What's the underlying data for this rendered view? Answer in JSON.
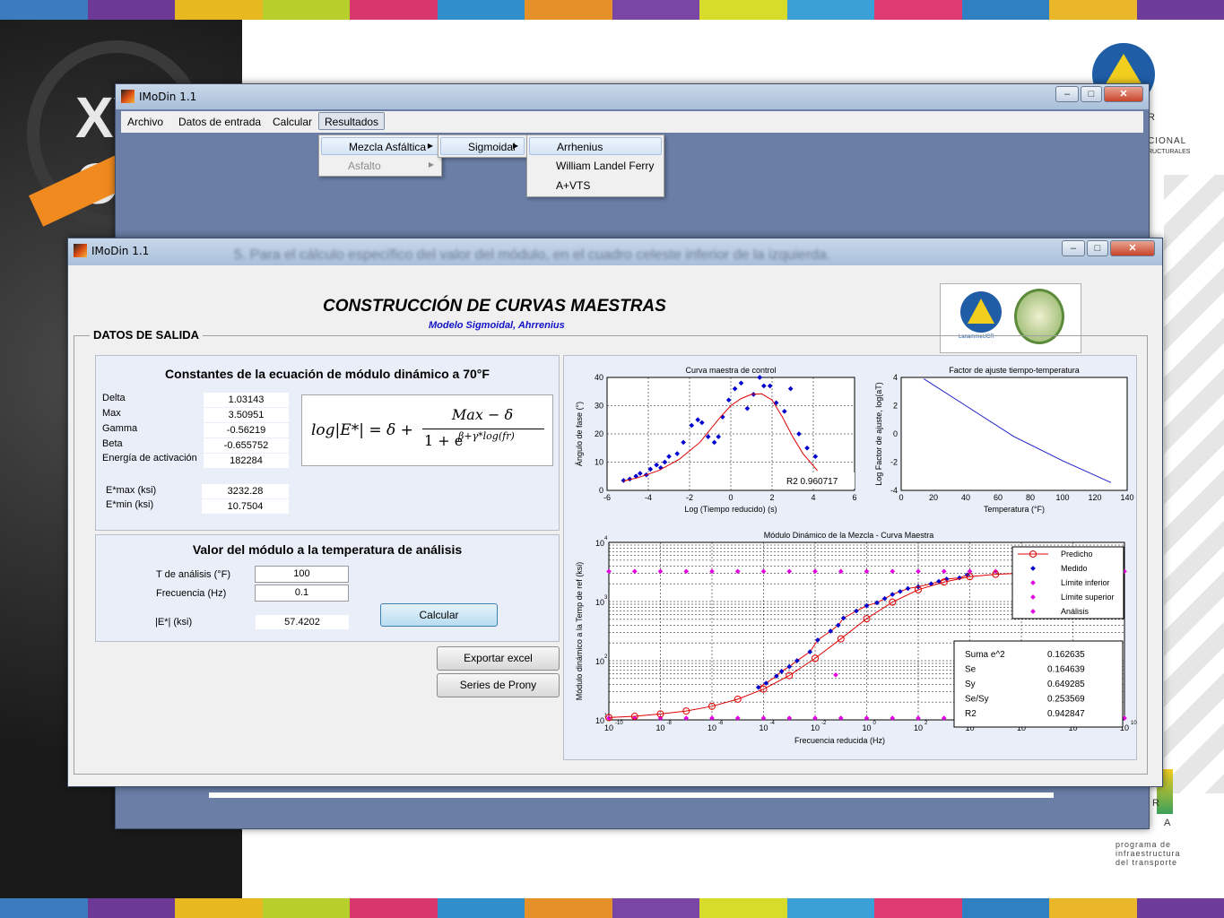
{
  "colors": {
    "stripes": [
      "#3b7bbf",
      "#6c3a96",
      "#e8b821",
      "#b6cf2b",
      "#d8366c",
      "#2e8fca",
      "#e6902a",
      "#7a46a6",
      "#d7dc2a",
      "#3ba0d6",
      "#e03a73",
      "#2f7fc3",
      "#eab62a",
      "#6d3c9a"
    ],
    "app_bg": "#6a7ea6",
    "panel_bg": "#e9eef8",
    "window_bg": "#f0f0f0"
  },
  "background": {
    "side_logo_text": "XVII C",
    "corner_letters": [
      "R",
      "R",
      "A"
    ],
    "right_texts": [
      "CIONAL",
      "RUCTURALES"
    ],
    "bottom_right_text": [
      "programa de",
      "infraestructura",
      "del transporte"
    ]
  },
  "back_window": {
    "title": "IMoDin 1.1",
    "menu": [
      "Archivo",
      "Datos de entrada",
      "Calcular",
      "Resultados"
    ],
    "submenu1": [
      {
        "label": "Mezcla Asfáltica",
        "enabled": true
      },
      {
        "label": "Asfalto",
        "enabled": false
      }
    ],
    "submenu2": [
      "Sigmoidal"
    ],
    "submenu3": [
      "Arrhenius",
      "William Landel Ferry",
      "A+VTS"
    ]
  },
  "front_window": {
    "title": "IMoDin 1.1",
    "blurred_text": "5.   Para el cálculo específico del valor del módulo, en el cuadro celeste inferior de la izquierda.",
    "heading": "CONSTRUCCIÓN DE CURVAS MAESTRAS",
    "subheading": "Modelo Sigmoidal, Ahrrenius",
    "logo_caption": "LanammeUCR",
    "section_title": "DATOS DE SALIDA",
    "constants_title": "Constantes de la ecuación de módulo dinámico a 70°F",
    "constants": [
      {
        "label": "Delta",
        "value": "1.03143"
      },
      {
        "label": "Max",
        "value": "3.50951"
      },
      {
        "label": "Gamma",
        "value": "-0.56219"
      },
      {
        "label": "Beta",
        "value": "-0.655752"
      },
      {
        "label": "Energía de activación",
        "value": "182284"
      }
    ],
    "extremes": [
      {
        "label": "E*max (ksi)",
        "value": "3232.28"
      },
      {
        "label": "E*min (ksi)",
        "value": "10.7504"
      }
    ],
    "formula": {
      "lhs": "log|E*| = δ +",
      "numerator": "Max − δ",
      "denominator": "1 + e",
      "exponent": "β+γ*log(fr)"
    },
    "module_title": "Valor del módulo a la temperatura de análisis",
    "inputs": [
      {
        "label": "T de análisis (°F)",
        "value": "100"
      },
      {
        "label": "Frecuencia (Hz)",
        "value": "0.1"
      }
    ],
    "result": {
      "label": "|E*| (ksi)",
      "value": "57.4202"
    },
    "buttons": {
      "calcular": "Calcular",
      "exportar": "Exportar excel",
      "prony": "Series de Prony"
    }
  },
  "chart_data": [
    {
      "type": "scatter",
      "title": "Curva maestra de control",
      "xlabel": "Log (Tiempo reducido) (s)",
      "ylabel": "Ángulo de fase (°)",
      "xlim": [
        -6,
        6
      ],
      "ylim": [
        0,
        40
      ],
      "xticks": [
        -6,
        -4,
        -2,
        0,
        2,
        4,
        6
      ],
      "yticks": [
        0,
        10,
        20,
        30,
        40
      ],
      "grid": true,
      "annotation": "R2   0.960717",
      "series": [
        {
          "kind": "points",
          "color": "#0000d0",
          "x": [
            -5.2,
            -4.9,
            -4.6,
            -4.4,
            -4.1,
            -3.9,
            -3.6,
            -3.4,
            -3.2,
            -3.0,
            -2.6,
            -2.3,
            -1.9,
            -1.6,
            -1.4,
            -1.1,
            -0.8,
            -0.6,
            -0.4,
            -0.1,
            0.2,
            0.5,
            0.8,
            1.1,
            1.4,
            1.6,
            1.9,
            2.2,
            2.6,
            2.9,
            3.3,
            3.7,
            4.1
          ],
          "y": [
            3.5,
            4,
            5,
            6,
            5.5,
            7.5,
            9,
            8,
            10,
            12,
            13,
            17,
            23,
            25,
            24,
            19,
            17,
            19,
            26,
            32,
            36,
            38,
            29,
            34,
            40,
            37,
            37,
            31,
            28,
            36,
            20,
            15,
            12
          ]
        },
        {
          "kind": "line",
          "color": "#e00000",
          "x": [
            -5.2,
            -4.5,
            -3.5,
            -2.5,
            -1.5,
            -0.5,
            0,
            0.5,
            1,
            1.5,
            2,
            2.5,
            3,
            3.5,
            4.2
          ],
          "y": [
            3.3,
            4.5,
            7,
            11,
            17,
            26,
            30,
            32.5,
            34,
            34.2,
            32,
            26,
            19,
            13,
            7
          ]
        }
      ]
    },
    {
      "type": "line",
      "title": "Factor de ajuste tiempo-temperatura",
      "xlabel": "Temperatura (°F)",
      "ylabel": "Log Factor de ajuste, log(aT)",
      "xlim": [
        0,
        140
      ],
      "ylim": [
        -4,
        4
      ],
      "xticks": [
        0,
        20,
        40,
        60,
        80,
        100,
        120,
        140
      ],
      "yticks": [
        -4,
        -2,
        0,
        2,
        4
      ],
      "series": [
        {
          "kind": "line",
          "color": "#2020c8",
          "x": [
            14,
            40,
            70,
            100,
            130
          ],
          "y": [
            3.9,
            2.0,
            -0.2,
            -1.9,
            -3.45
          ]
        }
      ]
    },
    {
      "type": "line",
      "title": "Módulo Dinámico de la Mezcla - Curva Maestra",
      "xlabel": "Frecuencia reducida (Hz)",
      "ylabel": "Módulo dinámico a la Temp de ref (ksi)",
      "xscale": "log",
      "yscale": "log",
      "xlim_exp": [
        -10,
        10
      ],
      "ylim_exp": [
        1,
        4
      ],
      "xticks_exp": [
        -10,
        -8,
        -6,
        -4,
        -2,
        0,
        2,
        4,
        6,
        8,
        10
      ],
      "yticks_exp": [
        1,
        2,
        3,
        4
      ],
      "legend_position": "top-right",
      "legend": [
        "Predicho",
        "Medido",
        "Límite inferior",
        "Límite superior",
        "Análisis"
      ],
      "stats": [
        {
          "label": "Suma e^2",
          "value": "0.162635"
        },
        {
          "label": "Se",
          "value": "0.164639"
        },
        {
          "label": "Sy",
          "value": "0.649285"
        },
        {
          "label": "Se/Sy",
          "value": "0.253569"
        },
        {
          "label": "R2",
          "value": "0.942847"
        }
      ],
      "series": [
        {
          "name": "Predicho",
          "kind": "line_circles",
          "color": "#e00000",
          "logx": [
            -10,
            -9,
            -8,
            -7,
            -6,
            -5,
            -4,
            -3,
            -2,
            -1,
            0,
            1,
            2,
            3,
            4,
            5,
            6
          ],
          "logy": [
            1.04,
            1.06,
            1.1,
            1.15,
            1.23,
            1.35,
            1.52,
            1.75,
            2.04,
            2.37,
            2.71,
            2.99,
            3.2,
            3.33,
            3.42,
            3.46,
            3.48
          ]
        },
        {
          "name": "Medido",
          "kind": "points",
          "color": "#0000d0",
          "logx": [
            -4.2,
            -3.9,
            -3.5,
            -3.3,
            -3.0,
            -2.7,
            -2.2,
            -1.9,
            -1.4,
            -1.1,
            -0.9,
            -0.4,
            0.0,
            0.4,
            0.7,
            1.0,
            1.3,
            1.6,
            2.0,
            2.5,
            2.8,
            3.1,
            3.6,
            3.9
          ],
          "logy": [
            1.55,
            1.62,
            1.74,
            1.82,
            1.9,
            2.0,
            2.15,
            2.35,
            2.5,
            2.6,
            2.72,
            2.84,
            2.93,
            2.98,
            3.05,
            3.12,
            3.17,
            3.22,
            3.25,
            3.3,
            3.34,
            3.38,
            3.4,
            3.45
          ]
        },
        {
          "name": "Límite inferior",
          "kind": "points",
          "color": "#e000e0",
          "logy_const": 1.03
        },
        {
          "name": "Límite superior",
          "kind": "points",
          "color": "#e000e0",
          "logy_const": 3.51
        },
        {
          "name": "Análisis",
          "kind": "points",
          "color": "#e000e0",
          "logx": [
            -1.2
          ],
          "logy": [
            1.76
          ]
        }
      ]
    }
  ]
}
